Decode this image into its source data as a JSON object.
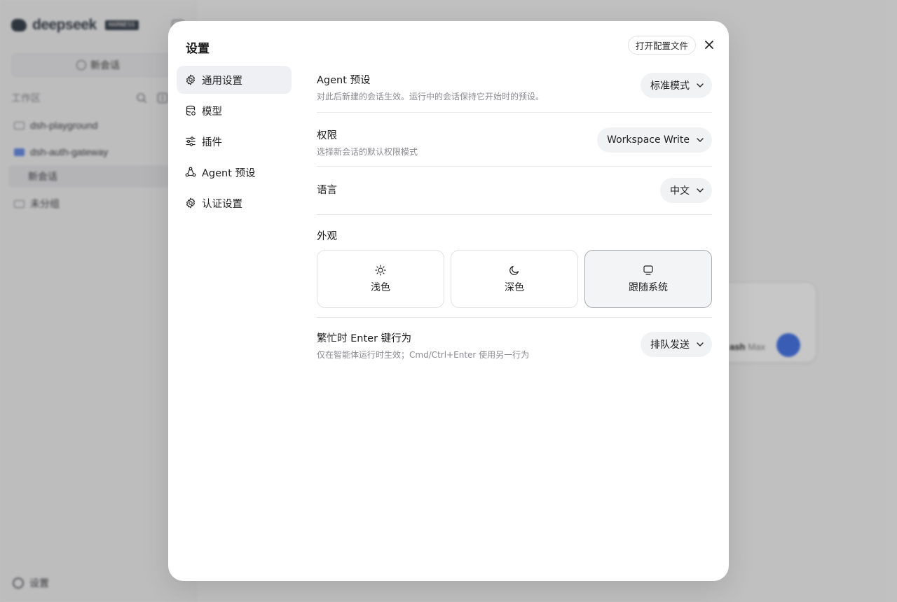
{
  "background": {
    "brand": "deepseek",
    "brand_badge": "HARNESS",
    "new_chat": "新会话",
    "workspace_label": "工作区",
    "workspace_items": [
      {
        "label": "dsh-playground",
        "icon": "folder-icon"
      },
      {
        "label": "dsh-auth-gateway",
        "icon": "folder-icon"
      },
      {
        "label": "新会话",
        "icon": ""
      },
      {
        "label": "未分组",
        "icon": "folder-icon"
      }
    ],
    "settings_label": "设置",
    "composer_model": "ash",
    "composer_mode": "Max"
  },
  "modal": {
    "title": "设置",
    "open_config": "打开配置文件",
    "close_icon": "close-icon"
  },
  "nav": [
    {
      "label": "通用设置",
      "icon": "gear-icon",
      "active": true
    },
    {
      "label": "模型",
      "icon": "database-icon",
      "active": false
    },
    {
      "label": "插件",
      "icon": "sliders-icon",
      "active": false
    },
    {
      "label": "Agent 预设",
      "icon": "agent-icon",
      "active": false
    },
    {
      "label": "认证设置",
      "icon": "gear-icon",
      "active": false
    }
  ],
  "settings": {
    "agent_preset": {
      "label": "Agent 预设",
      "desc": "对此后新建的会话生效。运行中的会话保持它开始时的预设。",
      "value": "标准模式"
    },
    "permission": {
      "label": "权限",
      "desc": "选择新会话的默认权限模式",
      "value": "Workspace Write"
    },
    "language": {
      "label": "语言",
      "value": "中文"
    },
    "appearance": {
      "label": "外观",
      "options": [
        {
          "label": "浅色",
          "icon": "sun-icon"
        },
        {
          "label": "深色",
          "icon": "moon-icon"
        },
        {
          "label": "跟随系统",
          "icon": "monitor-icon"
        }
      ],
      "selected": "跟随系统"
    },
    "busy_enter": {
      "label": "繁忙时 Enter 键行为",
      "desc": "仅在智能体运行时生效；Cmd/Ctrl+Enter 使用另一行为",
      "value": "排队发送"
    }
  },
  "colors": {
    "accent": "#4a78e8",
    "selected_bg": "#eef0f3",
    "pill_bg": "#f1f2f4"
  }
}
